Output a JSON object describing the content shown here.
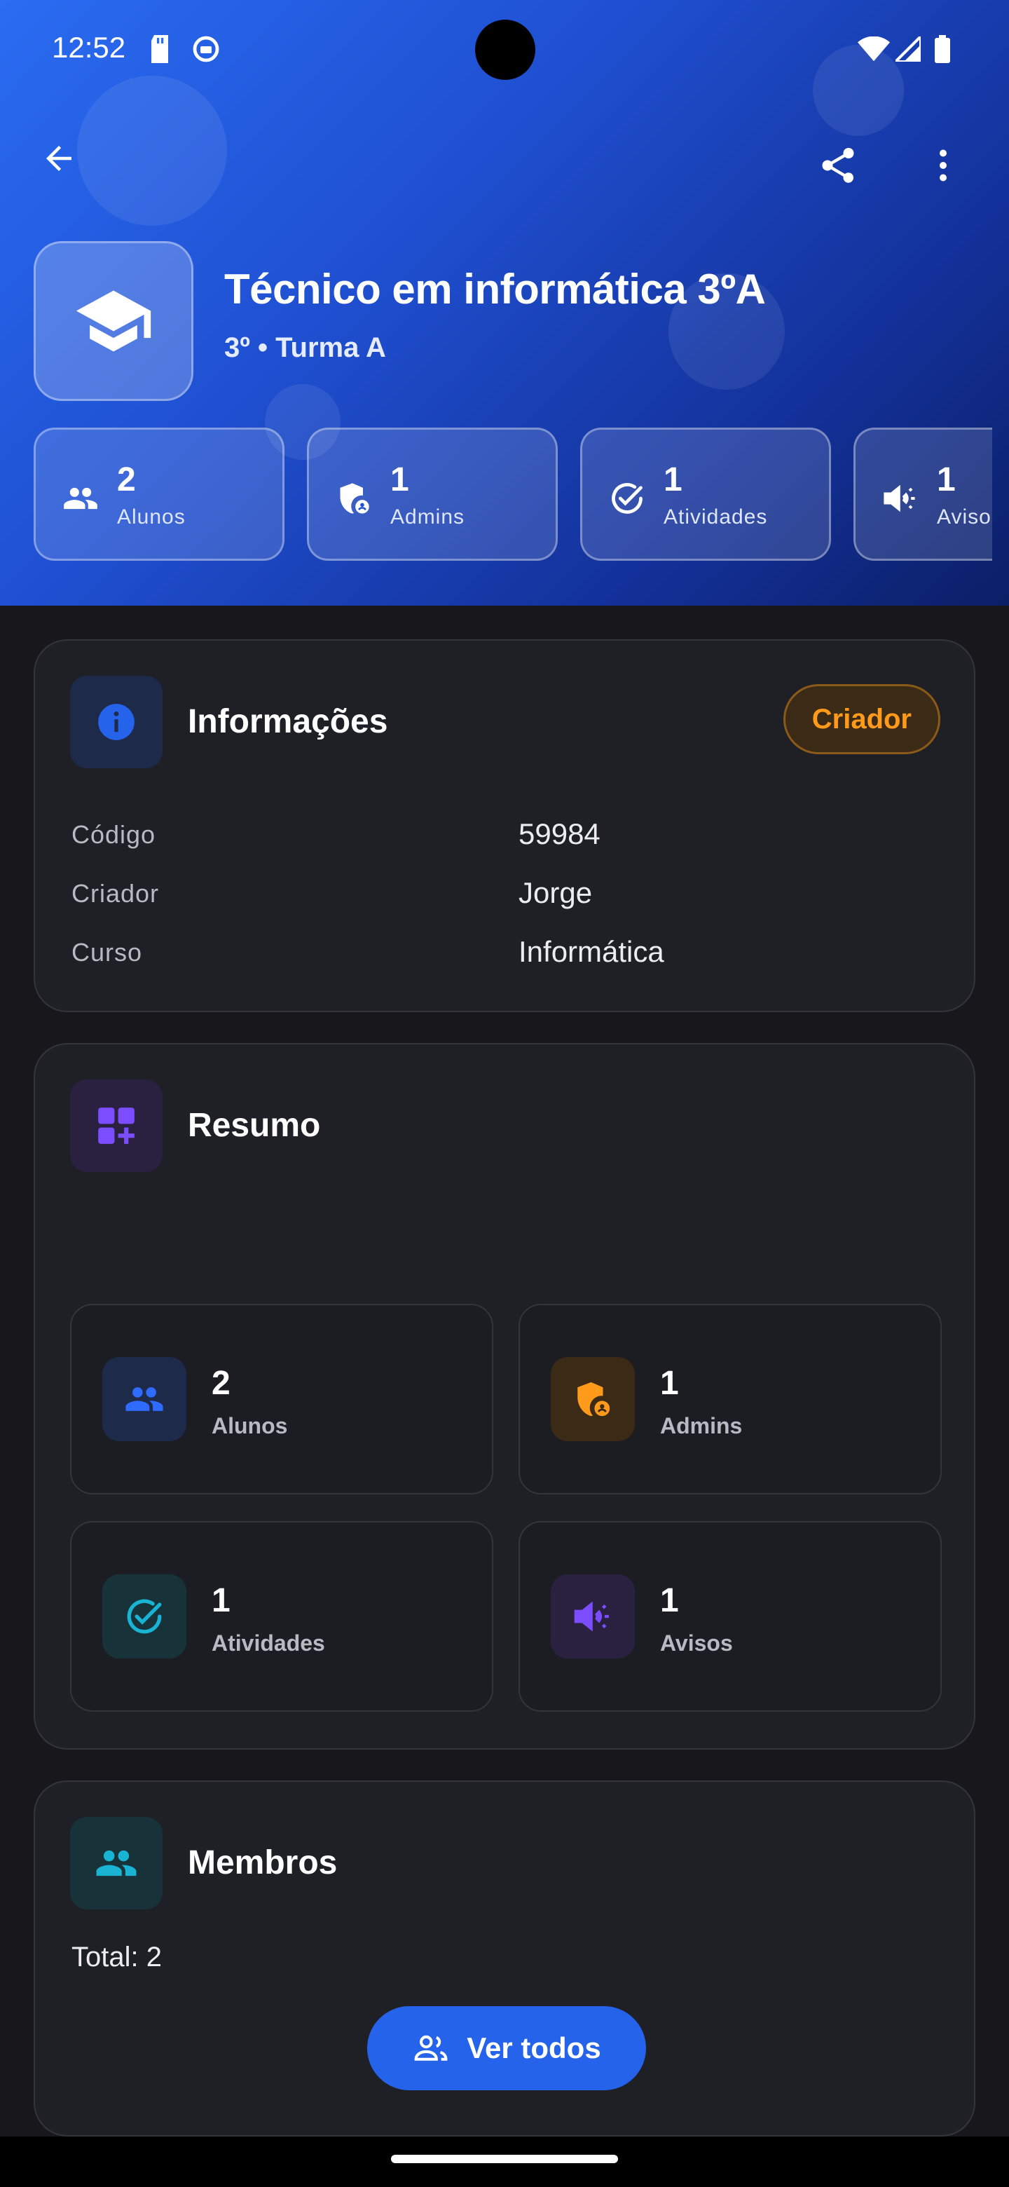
{
  "status_bar": {
    "time": "12:52"
  },
  "header": {
    "title": "Técnico em informática 3ºA",
    "subtitle": "3º • Turma A",
    "stats": [
      {
        "value": "2",
        "label": "Alunos",
        "icon": "people-icon"
      },
      {
        "value": "1",
        "label": "Admins",
        "icon": "admin-shield-icon"
      },
      {
        "value": "1",
        "label": "Atividades",
        "icon": "check-circle-icon"
      },
      {
        "value": "1",
        "label": "Avisos",
        "icon": "megaphone-icon"
      }
    ]
  },
  "info_card": {
    "title": "Informações",
    "badge": "Criador",
    "rows": [
      {
        "label": "Código",
        "value": "59984"
      },
      {
        "label": "Criador",
        "value": "Jorge"
      },
      {
        "label": "Curso",
        "value": "Informática"
      }
    ]
  },
  "summary_card": {
    "title": "Resumo",
    "tiles": [
      {
        "value": "2",
        "label": "Alunos"
      },
      {
        "value": "1",
        "label": "Admins"
      },
      {
        "value": "1",
        "label": "Atividades"
      },
      {
        "value": "1",
        "label": "Avisos"
      }
    ]
  },
  "members_card": {
    "title": "Membros",
    "total": "Total: 2",
    "button_label": "Ver todos"
  },
  "colors": {
    "accent_blue": "#2563eb",
    "badge_orange": "#ff9a1a",
    "purple": "#7c4dff",
    "cyan": "#19b4d4"
  }
}
